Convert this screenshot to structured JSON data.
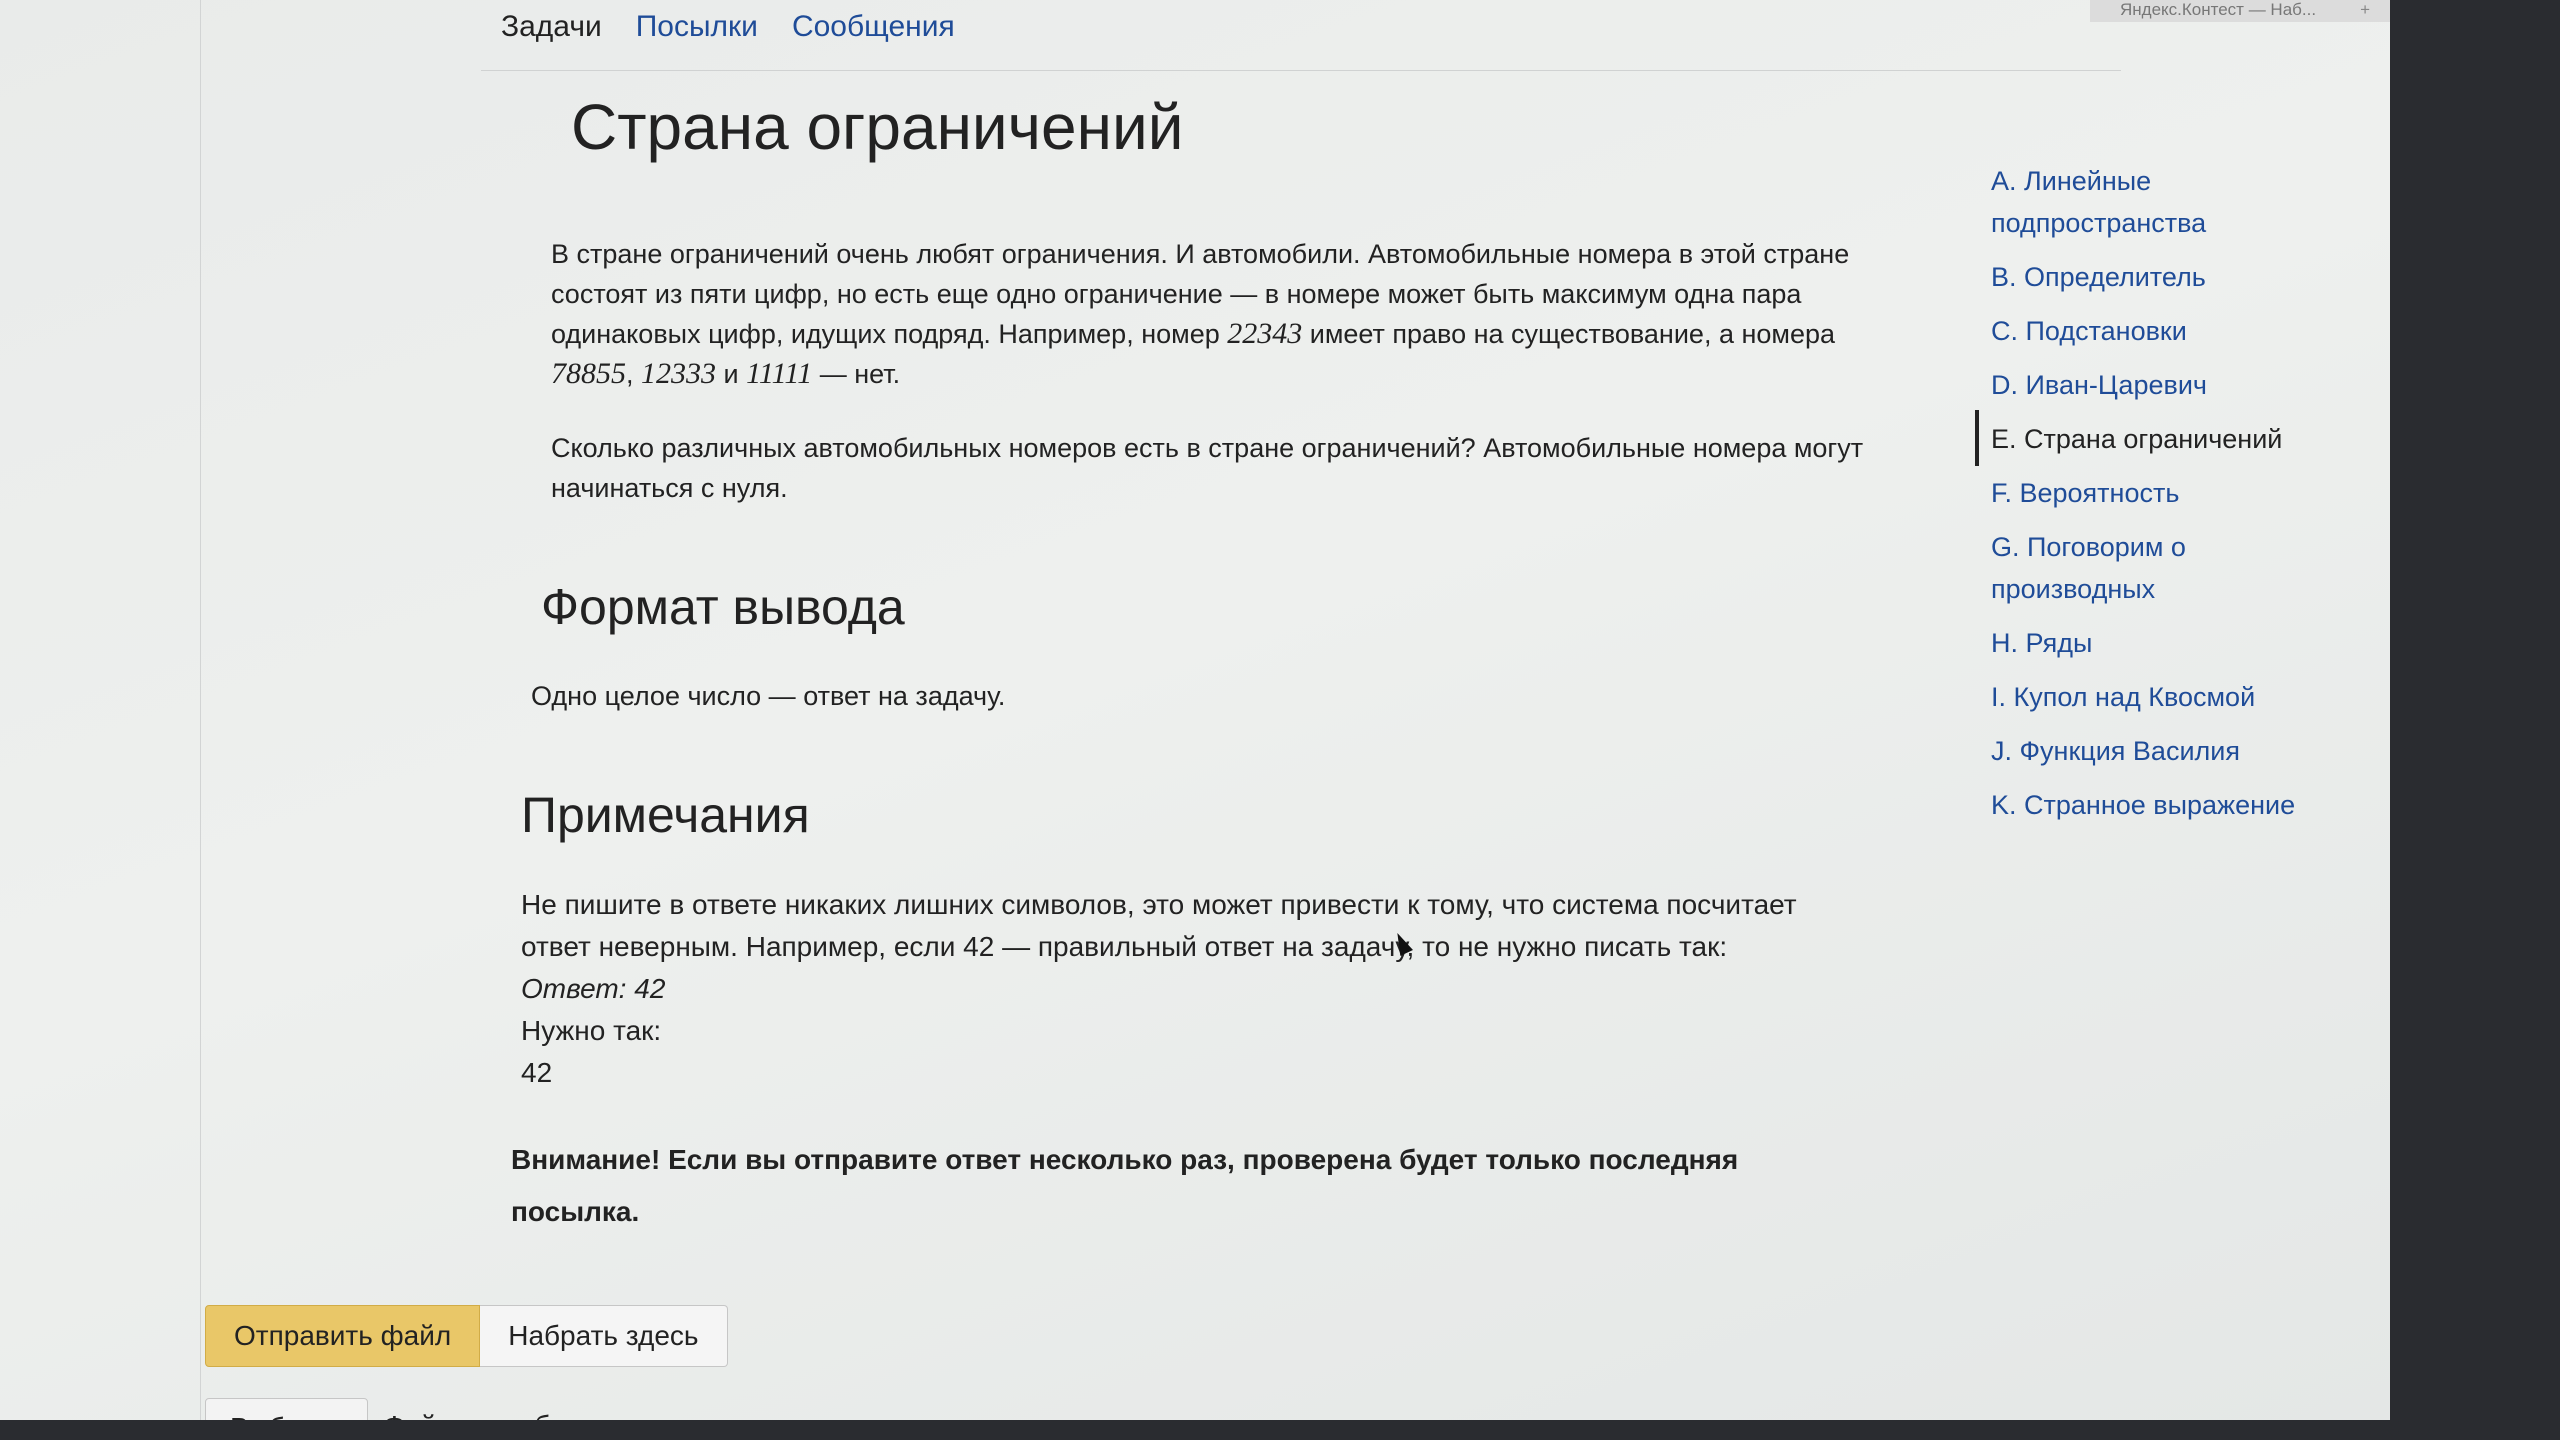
{
  "window": {
    "tab_title": "Яндекс.Контест — Наб..."
  },
  "nav": {
    "tabs": [
      {
        "label": "Задачи"
      },
      {
        "label": "Посылки"
      },
      {
        "label": "Сообщения"
      }
    ]
  },
  "problem": {
    "title": "Страна ограничений",
    "statement": {
      "p1_a": "В стране ограничений очень любят ограничения. И автомобили. Автомобильные номера в этой стране состоят из пяти цифр, но есть еще одно ограничение — в номере может быть максимум одна пара одинаковых цифр, идущих подряд. Например, номер ",
      "example_good": "22343",
      "p1_b": " имеет право на существование, а номера ",
      "example_bad_1": "78855",
      "sep1": ", ",
      "example_bad_2": "12333",
      "sep2": " и ",
      "example_bad_3": "11111",
      "p1_c": " — нет.",
      "p2": "Сколько различных автомобильных номеров есть в стране ограничений? Автомобильные номера могут начинаться с нуля."
    },
    "output_format": {
      "heading": "Формат вывода",
      "text": "Одно целое число — ответ на задачу."
    },
    "notes": {
      "heading": "Примечания",
      "text": "Не пишите в ответе никаких лишних символов, это может привести к тому, что система посчитает ответ неверным. Например, если 42 — правильный ответ на задачу, то не нужно писать так:",
      "wrong_example": "Ответ: 42",
      "need_label": "Нужно так:",
      "right_example": "42"
    },
    "warning": "Внимание! Если вы отправите ответ несколько раз, проверена будет только последняя посылка."
  },
  "submit": {
    "send_file_label": "Отправить файл",
    "type_here_label": "Набрать здесь",
    "choose_label": "Выбрать",
    "file_status": "Файл не выбран"
  },
  "sidebar": {
    "items": [
      {
        "label": "A. Линейные подпространства"
      },
      {
        "label": "B. Определитель"
      },
      {
        "label": "C. Подстановки"
      },
      {
        "label": "D. Иван-Царевич"
      },
      {
        "label": "E. Страна ограничений"
      },
      {
        "label": "F. Вероятность"
      },
      {
        "label": "G. Поговорим о производных"
      },
      {
        "label": "H. Ряды"
      },
      {
        "label": "I. Купол над Квосмой"
      },
      {
        "label": "J. Функция Василия"
      },
      {
        "label": "K. Странное выражение"
      }
    ],
    "current_index": 4
  },
  "colors": {
    "link": "#1f4c98",
    "primary_button": "#e9c768"
  }
}
